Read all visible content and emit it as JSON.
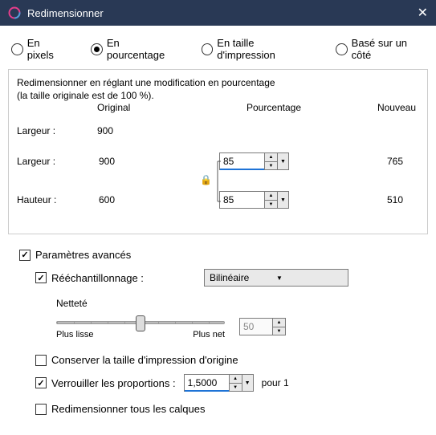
{
  "window": {
    "title": "Redimensionner"
  },
  "modes": {
    "pixels": "En pixels",
    "percent": "En pourcentage",
    "print": "En taille d'impression",
    "side": "Basé sur un côté",
    "selected": "percent"
  },
  "group": {
    "desc1": "Redimensionner en réglant une modification en pourcentage",
    "desc2": "(la taille originale est de 100 %).",
    "col_original": "Original",
    "col_percent": "Pourcentage",
    "col_new": "Nouveau",
    "width_label": "Largeur :",
    "height_label": "Hauteur :",
    "width_orig": "900",
    "height_orig": "600",
    "width_pct": "85",
    "height_pct": "85",
    "width_new": "765",
    "height_new": "510"
  },
  "advanced": {
    "label": "Paramètres avancés",
    "resample_label": "Rééchantillonnage :",
    "resample_value": "Bilinéaire",
    "sharpness_label": "Netteté",
    "sharp_more_smooth": "Plus lisse",
    "sharp_more_sharp": "Plus net",
    "sharp_value": "50",
    "preserve_print": "Conserver la taille d'impression d'origine",
    "lock_ratio_label": "Verrouiller les proportions :",
    "lock_ratio_value": "1,5000",
    "lock_ratio_suffix": "pour 1",
    "resize_all_layers": "Redimensionner tous les calques"
  }
}
